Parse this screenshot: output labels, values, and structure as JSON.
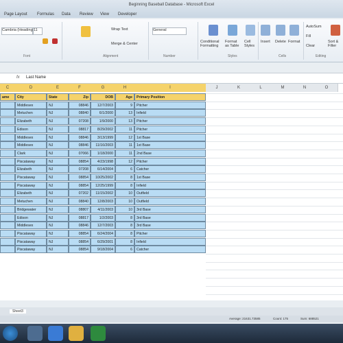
{
  "window": {
    "title": "Beginning Baseball Database - Microsoft Excel"
  },
  "ribbon_tabs": [
    "Page Layout",
    "Formulas",
    "Data",
    "Review",
    "View",
    "Developer"
  ],
  "ribbon": {
    "font_name": "Cambria (Headings)",
    "font_size": "11",
    "wrap_text": "Wrap Text",
    "merge_center": "Merge & Center",
    "number_format": "General",
    "conditional_formatting": "Conditional Formatting",
    "format_as_table": "Format as Table",
    "cell_styles": "Cell Styles",
    "insert": "Insert",
    "delete": "Delete",
    "format": "Format",
    "autosum": "AutoSum",
    "fill": "Fill",
    "clear": "Clear",
    "sort_filter": "Sort & Filter",
    "groups": [
      "Font",
      "Alignment",
      "Number",
      "Styles",
      "Cells",
      "Editing"
    ]
  },
  "formula_bar": {
    "fx": "fx",
    "value": "Last Name"
  },
  "columns": [
    "C",
    "D",
    "E",
    "F",
    "G",
    "H",
    "I",
    "J",
    "K",
    "L",
    "M",
    "N",
    "O"
  ],
  "table": {
    "headers": [
      "ame",
      "City",
      "State",
      "Zip",
      "DOB",
      "Age",
      "Primary Position"
    ],
    "rows": [
      [
        "",
        "Middlesex",
        "NJ",
        "08846",
        "12/7/2003",
        "9",
        "Pitcher"
      ],
      [
        "",
        "Metuchen",
        "NJ",
        "08840",
        "6/1/2000",
        "13",
        "Infield"
      ],
      [
        "",
        "Elizabeth",
        "NJ",
        "07208",
        "1/9/2000",
        "13",
        "Pitcher"
      ],
      [
        "",
        "Edison",
        "NJ",
        "08817",
        "8/29/2002",
        "11",
        "Pitcher"
      ],
      [
        "",
        "Middlesex",
        "NJ",
        "08846",
        "3/13/1999",
        "12",
        "1st Base"
      ],
      [
        "",
        "Middlesex",
        "NJ",
        "08846",
        "11/16/2003",
        "11",
        "1st Base"
      ],
      [
        "",
        "Clark",
        "NJ",
        "07066",
        "1/18/2000",
        "11",
        "2nd Base"
      ],
      [
        "",
        "Piscataway",
        "NJ",
        "08854",
        "4/23/1998",
        "12",
        "Pitcher"
      ],
      [
        "",
        "Elizabeth",
        "NJ",
        "07208",
        "6/14/2004",
        "6",
        "Catcher"
      ],
      [
        "",
        "Piscataway",
        "NJ",
        "08854",
        "10/25/2002",
        "8",
        "1st Base"
      ],
      [
        "",
        "Piscataway",
        "NJ",
        "08854",
        "12/25/1999",
        "8",
        "Infield"
      ],
      [
        "",
        "Elizabeth",
        "NJ",
        "07202",
        "11/15/2002",
        "10",
        "Outfield"
      ],
      [
        "",
        "Metuchen",
        "NJ",
        "08840",
        "12/8/2003",
        "10",
        "Outfield"
      ],
      [
        "",
        "Bridgewater",
        "NJ",
        "08807",
        "4/11/2003",
        "10",
        "3rd Base"
      ],
      [
        "",
        "Edison",
        "NJ",
        "08817",
        "1/2/2003",
        "8",
        "3rd Base"
      ],
      [
        "",
        "Middlesex",
        "NJ",
        "08846",
        "12/7/2003",
        "8",
        "3rd Base"
      ],
      [
        "",
        "Piscataway",
        "NJ",
        "08854",
        "6/24/2004",
        "8",
        "Pitcher"
      ],
      [
        "",
        "Piscataway",
        "NJ",
        "08854",
        "6/29/2001",
        "8",
        "Infield"
      ],
      [
        "",
        "Piscataway",
        "NJ",
        "08854",
        "9/18/2004",
        "6",
        "Catcher"
      ]
    ]
  },
  "sheet_tab": "Sheet3",
  "status": {
    "average": "Average: 21631.73585",
    "count": "Count: 175",
    "sum": "Sum: 688521"
  },
  "colors": {
    "header_fill": "#f5d36b",
    "row_fill": "#b9dcf4",
    "taskbar": "#1d2a3a"
  }
}
